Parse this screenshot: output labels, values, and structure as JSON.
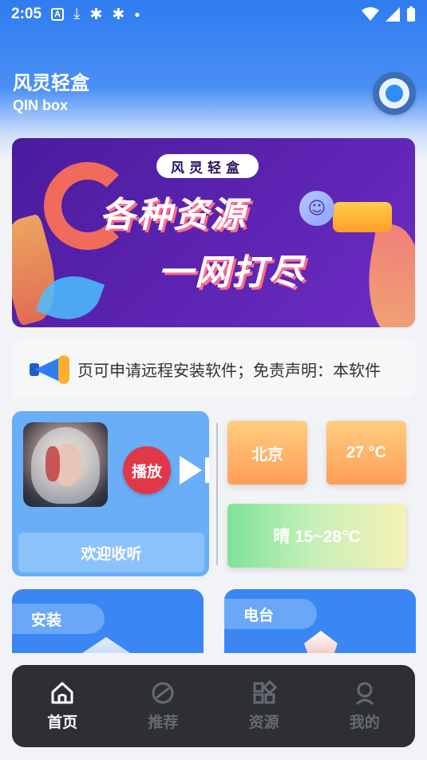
{
  "status_bar": {
    "time": "2:05",
    "icons": [
      "app-icon-a",
      "download-icon",
      "bug-icon",
      "bug-icon",
      "dot-icon"
    ],
    "right_icons": [
      "wifi-icon",
      "signal-icon",
      "battery-icon"
    ]
  },
  "header": {
    "title": "风灵轻盒",
    "subtitle": "QIN box"
  },
  "banner": {
    "pill_text": "风灵轻盒",
    "line1": "各种资源",
    "line2": "一网打尽"
  },
  "notice": {
    "icon": "megaphone-icon",
    "text": "页可申请远程安装软件；免责声明：本软件"
  },
  "player": {
    "play_label": "播放",
    "welcome_label": "欢迎收听"
  },
  "weather": {
    "city": "北京",
    "temperature": "27 °C",
    "forecast": "晴 15~28°C"
  },
  "tiles": {
    "install_label": "安装",
    "radio_label": "电台"
  },
  "tabbar": {
    "items": [
      {
        "label": "首页",
        "icon": "home-icon",
        "active": true
      },
      {
        "label": "推荐",
        "icon": "compass-icon",
        "active": false
      },
      {
        "label": "资源",
        "icon": "grid-icon",
        "active": false
      },
      {
        "label": "我的",
        "icon": "user-icon",
        "active": false
      }
    ]
  },
  "colors": {
    "primary": "#2f7cf0",
    "tabbar_bg": "#2d2f35",
    "play_red": "#e03848",
    "weather_orange": "#ff9d58",
    "weather_green": "#7fe39a"
  }
}
